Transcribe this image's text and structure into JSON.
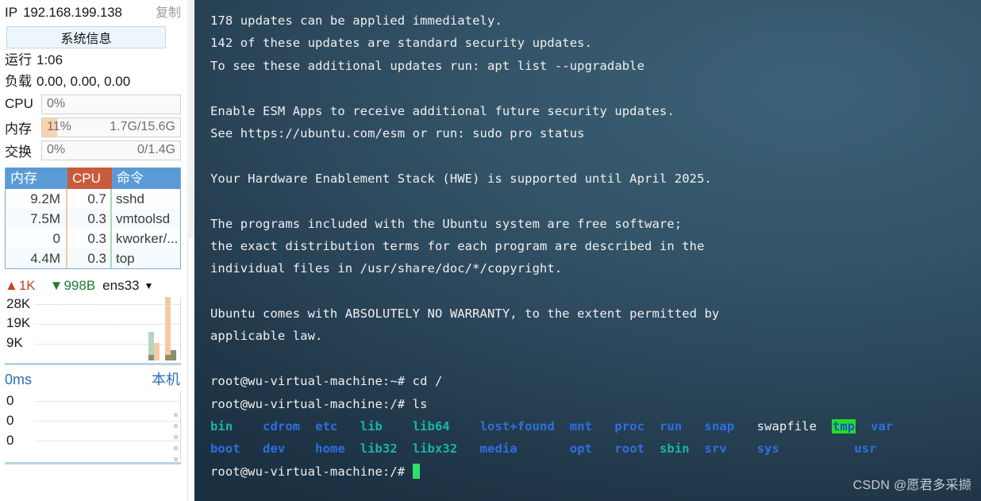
{
  "sidebar": {
    "ip": {
      "label": "IP",
      "value": "192.168.199.138",
      "copy_label": "复制"
    },
    "sysinfo_button": "系统信息",
    "uptime": {
      "key": "运行",
      "value": "1:06"
    },
    "load": {
      "key": "负载",
      "value": "0.00, 0.00, 0.00"
    },
    "gauges": [
      {
        "key": "CPU",
        "percent_text": "0%",
        "percent": 0,
        "detail": ""
      },
      {
        "key": "内存",
        "percent_text": "11%",
        "percent": 11,
        "detail": "1.7G/15.6G"
      },
      {
        "key": "交换",
        "percent_text": "0%",
        "percent": 0,
        "detail": "0/1.4G"
      }
    ],
    "process_table": {
      "headers": {
        "mem": "内存",
        "cpu": "CPU",
        "cmd": "命令"
      },
      "rows": [
        {
          "mem": "9.2M",
          "cpu": "0.7",
          "cmd": "sshd"
        },
        {
          "mem": "7.5M",
          "cpu": "0.3",
          "cmd": "vmtoolsd"
        },
        {
          "mem": "0",
          "cpu": "0.3",
          "cmd": "kworker/..."
        },
        {
          "mem": "4.4M",
          "cpu": "0.3",
          "cmd": "top"
        }
      ]
    },
    "network": {
      "up_arrow": "up-arrow-icon",
      "up_value": "1K",
      "down_arrow": "down-arrow-icon",
      "down_value": "998B",
      "interface": "ens33",
      "caret": "chevron-down-icon",
      "y_labels": [
        "28K",
        "19K",
        "9K"
      ],
      "colors": {
        "up": "#f3c9a6",
        "down": "#b7d4c0",
        "up_base": "#9b8a5e",
        "down_base": "#8a8f6a"
      }
    },
    "ping": {
      "latency": "0ms",
      "host": "本机",
      "y_labels": [
        "0",
        "0",
        "0"
      ]
    }
  },
  "terminal": {
    "lines": [
      {
        "type": "text",
        "segs": [
          {
            "t": "178 updates can be applied immediately.",
            "c": "c-white"
          }
        ]
      },
      {
        "type": "text",
        "segs": [
          {
            "t": "142 of these updates are standard security updates.",
            "c": "c-white"
          }
        ]
      },
      {
        "type": "text",
        "segs": [
          {
            "t": "To see these additional updates run: apt list --upgradable",
            "c": "c-white"
          }
        ]
      },
      {
        "type": "blank"
      },
      {
        "type": "text",
        "segs": [
          {
            "t": "Enable ESM Apps to receive additional future security updates.",
            "c": "c-white"
          }
        ]
      },
      {
        "type": "text",
        "segs": [
          {
            "t": "See https://ubuntu.com/esm or run: sudo pro status",
            "c": "c-white"
          }
        ]
      },
      {
        "type": "blank"
      },
      {
        "type": "text",
        "segs": [
          {
            "t": "Your Hardware Enablement Stack (HWE) is supported until April 2025.",
            "c": "c-white"
          }
        ]
      },
      {
        "type": "blank"
      },
      {
        "type": "text",
        "segs": [
          {
            "t": "The programs included with the Ubuntu system are free software;",
            "c": "c-white"
          }
        ]
      },
      {
        "type": "text",
        "segs": [
          {
            "t": "the exact distribution terms for each program are described in the",
            "c": "c-white"
          }
        ]
      },
      {
        "type": "text",
        "segs": [
          {
            "t": "individual files in /usr/share/doc/*/copyright.",
            "c": "c-white"
          }
        ]
      },
      {
        "type": "blank"
      },
      {
        "type": "text",
        "segs": [
          {
            "t": "Ubuntu comes with ABSOLUTELY NO WARRANTY, to the extent permitted by",
            "c": "c-white"
          }
        ]
      },
      {
        "type": "text",
        "segs": [
          {
            "t": "applicable law.",
            "c": "c-white"
          }
        ]
      },
      {
        "type": "blank"
      },
      {
        "type": "text",
        "segs": [
          {
            "t": "root@wu-virtual-machine:~# cd /",
            "c": "c-white"
          }
        ]
      },
      {
        "type": "text",
        "segs": [
          {
            "t": "root@wu-virtual-machine:/# ls",
            "c": "c-white"
          }
        ]
      },
      {
        "type": "text",
        "segs": [
          {
            "t": "bin    ",
            "c": "c-link"
          },
          {
            "t": "cdrom  ",
            "c": "c-dir"
          },
          {
            "t": "etc   ",
            "c": "c-dir"
          },
          {
            "t": "lib    ",
            "c": "c-link"
          },
          {
            "t": "lib64    ",
            "c": "c-link"
          },
          {
            "t": "lost+found  ",
            "c": "c-dir"
          },
          {
            "t": "mnt   ",
            "c": "c-dir"
          },
          {
            "t": "proc  ",
            "c": "c-dir"
          },
          {
            "t": "run   ",
            "c": "c-dir"
          },
          {
            "t": "snap   ",
            "c": "c-dir"
          },
          {
            "t": "swapfile  ",
            "c": "c-white"
          },
          {
            "t": "tmp",
            "c": "c-sticky"
          },
          {
            "t": "  ",
            "c": "c-white"
          },
          {
            "t": "var",
            "c": "c-dir"
          }
        ]
      },
      {
        "type": "text",
        "segs": [
          {
            "t": "boot   ",
            "c": "c-dir"
          },
          {
            "t": "dev    ",
            "c": "c-dir"
          },
          {
            "t": "home  ",
            "c": "c-dir"
          },
          {
            "t": "lib32  ",
            "c": "c-link"
          },
          {
            "t": "libx32   ",
            "c": "c-link"
          },
          {
            "t": "media       ",
            "c": "c-dir"
          },
          {
            "t": "opt   ",
            "c": "c-dir"
          },
          {
            "t": "root  ",
            "c": "c-dir"
          },
          {
            "t": "sbin  ",
            "c": "c-link"
          },
          {
            "t": "srv    ",
            "c": "c-dir"
          },
          {
            "t": "sys       ",
            "c": "c-dir"
          },
          {
            "t": "   ",
            "c": "c-white"
          },
          {
            "t": "usr",
            "c": "c-dir"
          }
        ]
      },
      {
        "type": "prompt",
        "segs": [
          {
            "t": "root@wu-virtual-machine:/# ",
            "c": "c-white"
          }
        ]
      }
    ],
    "watermark": "CSDN @愿君多采撷"
  }
}
